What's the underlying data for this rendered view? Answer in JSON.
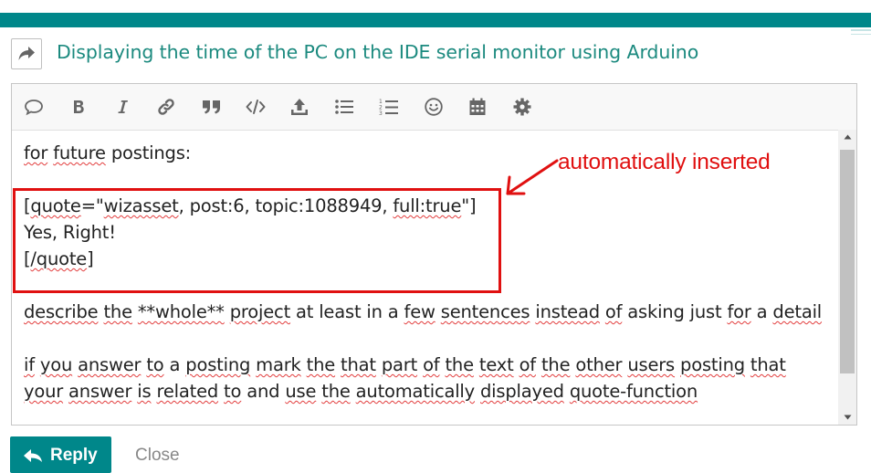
{
  "colors": {
    "brand": "#00878a",
    "title": "#1c8a7f",
    "annotation": "#e01010"
  },
  "composer": {
    "reply_icon": "share-arrow-icon",
    "topic_title": "Displaying the time of the PC on the IDE serial monitor using Arduino"
  },
  "toolbar": {
    "buttons": [
      {
        "name": "quote",
        "icon": "speech-bubble-icon"
      },
      {
        "name": "bold",
        "icon": "bold-icon"
      },
      {
        "name": "italic",
        "icon": "italic-icon"
      },
      {
        "name": "link",
        "icon": "link-icon"
      },
      {
        "name": "blockquote",
        "icon": "quote-icon"
      },
      {
        "name": "code",
        "icon": "code-icon"
      },
      {
        "name": "upload",
        "icon": "upload-icon"
      },
      {
        "name": "bullet-list",
        "icon": "bullet-list-icon"
      },
      {
        "name": "numbered-list",
        "icon": "numbered-list-icon"
      },
      {
        "name": "emoji",
        "icon": "smiley-icon"
      },
      {
        "name": "date",
        "icon": "calendar-icon"
      },
      {
        "name": "options",
        "icon": "gear-icon"
      }
    ]
  },
  "editor": {
    "lines": [
      "for future postings:",
      "",
      "[quote=\"wizasset, post:6, topic:1088949, full:true\"]",
      "Yes, Right!",
      "[/quote]",
      "",
      "describe the **whole** project at least in a few sentences instead of asking just for a detail",
      "",
      "if you answer to a posting mark the that part of the text of the other users posting that",
      "your answer is related to and use the automatically displayed quote-function"
    ]
  },
  "annotation": {
    "text": "automatically inserted"
  },
  "actions": {
    "reply_label": "Reply",
    "close_label": "Close"
  }
}
